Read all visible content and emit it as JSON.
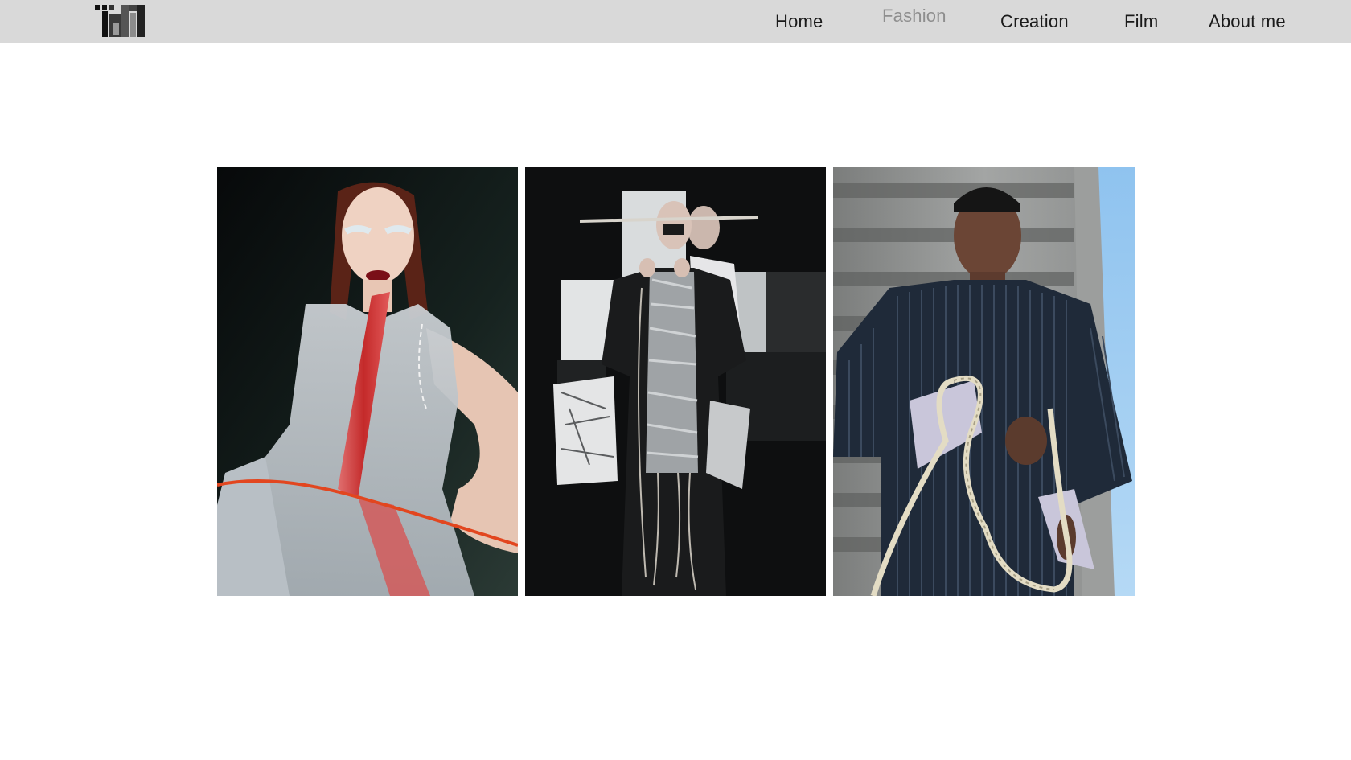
{
  "nav": {
    "items": [
      {
        "label": "Home"
      },
      {
        "label": "Fashion",
        "active": true
      },
      {
        "label": "Creation"
      },
      {
        "label": "Film"
      },
      {
        "label": "About me"
      }
    ],
    "active_color": "#8e8e8e",
    "text_color": "#1a1a1a",
    "bar_color": "#d9d9d9"
  },
  "logo": {
    "icon": "monogram-logo"
  },
  "gallery": {
    "images": [
      {
        "alt": "Model in sheer grey dress with red panel and orange cord"
      },
      {
        "alt": "Two models in dark textured garments with wooden stick prop"
      },
      {
        "alt": "Model in dark pleated top holding cream rope"
      }
    ]
  }
}
